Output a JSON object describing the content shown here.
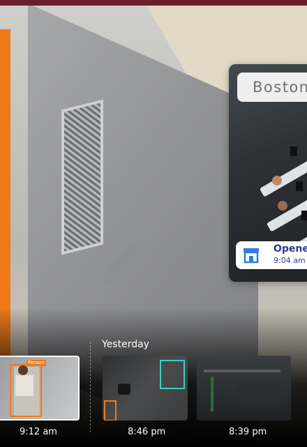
{
  "scene": {
    "location": "Boston",
    "event": {
      "title": "Opened",
      "time": "9:04 am",
      "icon": "storefront-icon"
    }
  },
  "timeline": {
    "day_label": "Yesterday",
    "thumbnails": [
      {
        "time": "9:12 am",
        "tag": "Person",
        "selected": true
      },
      {
        "time": "8:46 pm",
        "selected": false
      },
      {
        "time": "8:39 pm",
        "selected": false
      }
    ]
  },
  "colors": {
    "accent_orange": "#f07a18",
    "detection_teal": "#3bd0c2",
    "event_blue": "#2a3c8f",
    "brand_top": "#6b1e2b"
  }
}
